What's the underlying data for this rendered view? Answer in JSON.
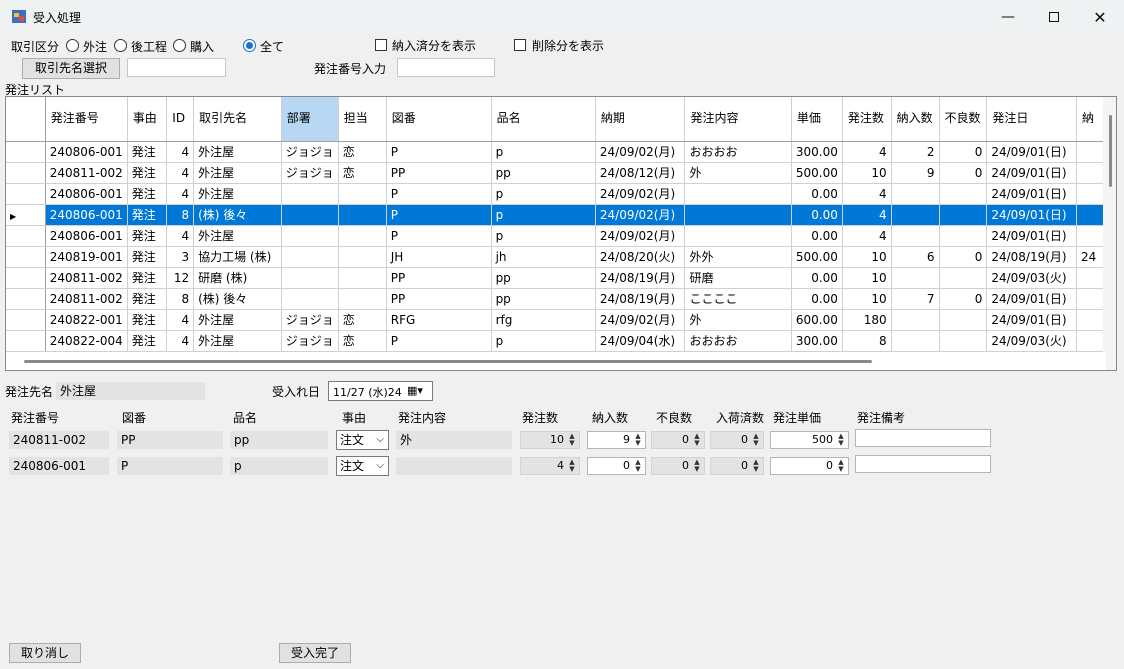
{
  "window": {
    "title": "受入処理",
    "minimize_icon": "minimize-icon",
    "maximize_icon": "maximize-icon",
    "close_icon": "close-icon"
  },
  "filters": {
    "partner_type_label": "取引区分",
    "radio_options": [
      "外注",
      "後工程",
      "購入",
      "全て"
    ],
    "selected_radio": "全て",
    "show_received_label": "納入済分を表示",
    "show_deleted_label": "削除分を表示",
    "select_partner_button": "取引先名選択",
    "partner_value": "",
    "order_no_label": "発注番号入力",
    "order_no_value": ""
  },
  "grid": {
    "caption": "発注リスト",
    "columns": [
      "発注番号",
      "事由",
      "ID",
      "取引先名",
      "部署",
      "担当",
      "図番",
      "品名",
      "納期",
      "発注内容",
      "単価",
      "発注数",
      "納入数",
      "不良数",
      "発注日",
      "納"
    ],
    "selected_column": "部署",
    "selected_row_index": 3,
    "rows": [
      [
        "240806-001",
        "発注",
        "4",
        "外注屋",
        "ジョジョ",
        "恋",
        "P",
        "p",
        "24/09/02(月)",
        "おおおお",
        "300.00",
        "4",
        "2",
        "0",
        "24/09/01(日)",
        ""
      ],
      [
        "240811-002",
        "発注",
        "4",
        "外注屋",
        "ジョジョ",
        "恋",
        "PP",
        "pp",
        "24/08/12(月)",
        "外",
        "500.00",
        "10",
        "9",
        "0",
        "24/09/01(日)",
        ""
      ],
      [
        "240806-001",
        "発注",
        "4",
        "外注屋",
        "",
        "",
        "P",
        "p",
        "24/09/02(月)",
        "",
        "0.00",
        "4",
        "",
        "",
        "24/09/01(日)",
        ""
      ],
      [
        "240806-001",
        "発注",
        "8",
        "(株) 後々",
        "",
        "",
        "P",
        "p",
        "24/09/02(月)",
        "",
        "0.00",
        "4",
        "",
        "",
        "24/09/01(日)",
        ""
      ],
      [
        "240806-001",
        "発注",
        "4",
        "外注屋",
        "",
        "",
        "P",
        "p",
        "24/09/02(月)",
        "",
        "0.00",
        "4",
        "",
        "",
        "24/09/01(日)",
        ""
      ],
      [
        "240819-001",
        "発注",
        "3",
        "協力工場 (株)",
        "",
        "",
        "JH",
        "jh",
        "24/08/20(火)",
        "外外",
        "500.00",
        "10",
        "6",
        "0",
        "24/08/19(月)",
        "24"
      ],
      [
        "240811-002",
        "発注",
        "12",
        "研磨 (株)",
        "",
        "",
        "PP",
        "pp",
        "24/08/19(月)",
        "研磨",
        "0.00",
        "10",
        "",
        "",
        "24/09/03(火)",
        ""
      ],
      [
        "240811-002",
        "発注",
        "8",
        "(株) 後々",
        "",
        "",
        "PP",
        "pp",
        "24/08/19(月)",
        "ここここ",
        "0.00",
        "10",
        "7",
        "0",
        "24/09/01(日)",
        ""
      ],
      [
        "240822-001",
        "発注",
        "4",
        "外注屋",
        "ジョジョ",
        "恋",
        "RFG",
        "rfg",
        "24/09/02(月)",
        "外",
        "600.00",
        "180",
        "",
        "",
        "24/09/01(日)",
        ""
      ],
      [
        "240822-004",
        "発注",
        "4",
        "外注屋",
        "ジョジョ",
        "恋",
        "P",
        "p",
        "24/09/04(水)",
        "おおおお",
        "300.00",
        "8",
        "",
        "",
        "24/09/03(火)",
        ""
      ]
    ]
  },
  "receive": {
    "partner_label": "発注先名",
    "partner_value": "外注屋",
    "date_label": "受入れ日",
    "date_value": "11/27 (水)24",
    "columns": [
      "発注番号",
      "図番",
      "品名",
      "事由",
      "発注内容",
      "発注数",
      "納入数",
      "不良数",
      "入荷済数",
      "発注単価",
      "発注備考"
    ],
    "rows": [
      {
        "order_no": "240811-002",
        "drawing": "PP",
        "item": "pp",
        "reason": "注文",
        "content": "外",
        "order_qty": "10",
        "delivered": "9",
        "defect": "0",
        "arrived": "0",
        "unit_price": "500",
        "remark": ""
      },
      {
        "order_no": "240806-001",
        "drawing": "P",
        "item": "p",
        "reason": "注文",
        "content": "",
        "order_qty": "4",
        "delivered": "0",
        "defect": "0",
        "arrived": "0",
        "unit_price": "0",
        "remark": ""
      }
    ]
  },
  "footer": {
    "cancel_button": "取り消し",
    "complete_button": "受入完了"
  },
  "colors": {
    "selection": "#0078d7",
    "selected_header": "#b8d7f2",
    "window_bg": "#f0f0f0"
  }
}
